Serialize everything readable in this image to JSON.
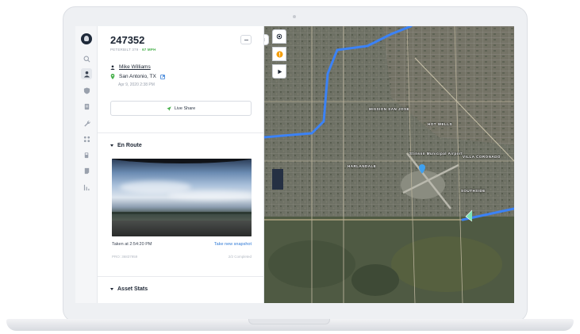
{
  "vehicle": {
    "id": "247352",
    "model": "PETERBILT 379",
    "speed": "67 MPH",
    "driver": "Mike Williams",
    "location": "San Antonio, TX",
    "timestamp": "Apr 9, 2020 2:38 PM"
  },
  "actions": {
    "live_share": "Live Share"
  },
  "sections": {
    "en_route": "En Route",
    "asset_stats": "Asset Stats"
  },
  "snapshot": {
    "taken_label": "Taken at 2:54:20 PM",
    "take_new": "Take new snapshot",
    "pro_number": "PRO: 36837959",
    "completed": "2/2 Completed"
  },
  "map": {
    "labels": [
      "MISSION SAN JOSE",
      "HOT WELLS",
      "HARLANDALE",
      "Stinson Municipal Airport",
      "VILLA CORONADO",
      "SOUTHSIDE"
    ]
  },
  "nav_icons": [
    "search-icon",
    "driver-icon",
    "shield-icon",
    "document-icon",
    "wrench-icon",
    "routes-icon",
    "fuel-icon",
    "notes-icon",
    "reports-icon"
  ],
  "colors": {
    "route": "#3b82f6",
    "accent_blue": "#2f7ad6",
    "speed_green": "#46b04a",
    "hazard_orange": "#f59e0b"
  }
}
